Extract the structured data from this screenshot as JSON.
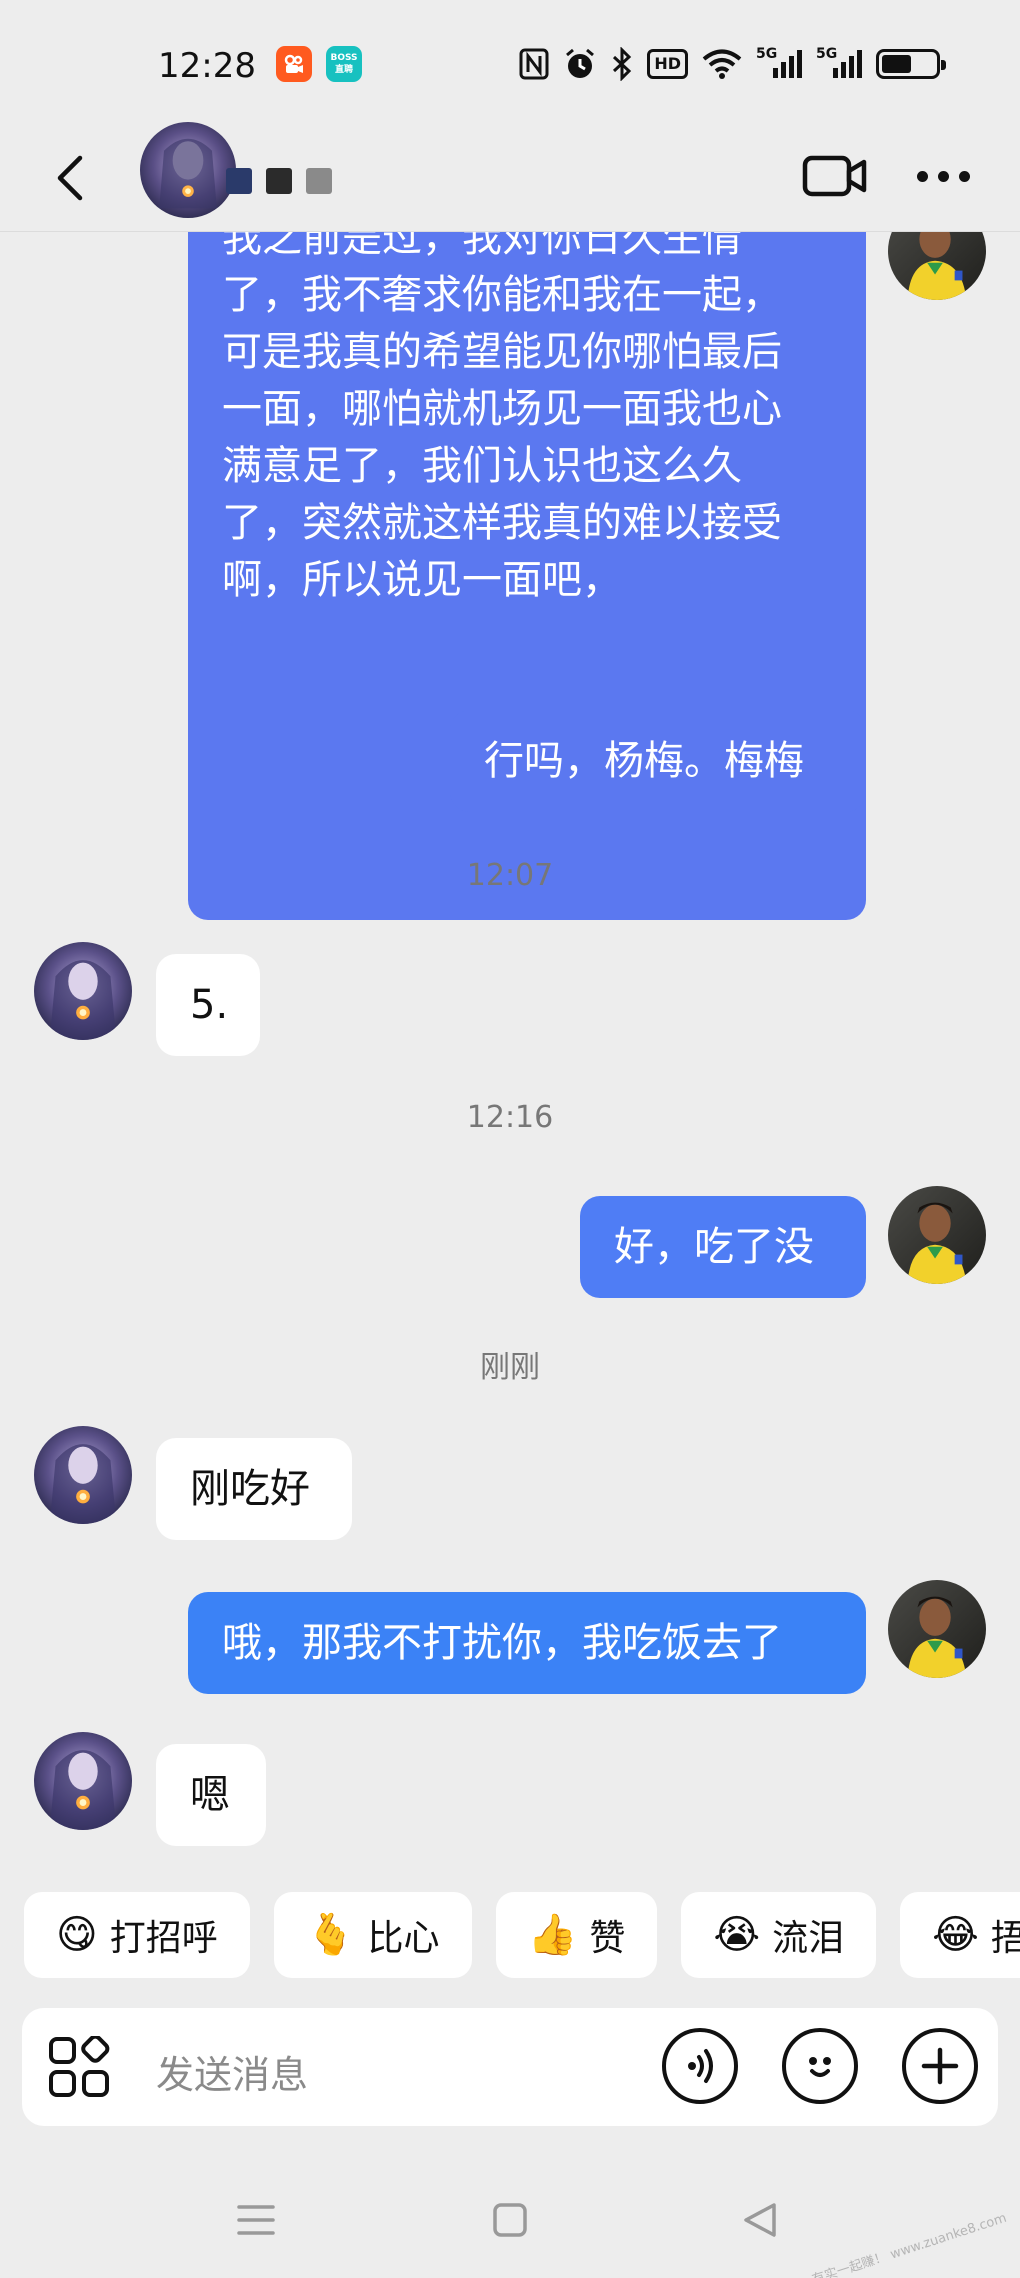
{
  "status_bar": {
    "time": "12:28",
    "apps": [
      {
        "name": "kuaishou-icon",
        "color": "#ff5a1f"
      },
      {
        "name": "boss-zhipin-icon",
        "line1": "BOSS",
        "line2": "直聘",
        "color": "#17c1c0"
      }
    ],
    "icons": [
      "nfc-icon",
      "alarm-icon",
      "bluetooth-icon",
      "hd-voice-icon",
      "wifi-icon",
      "signal-5g-icon",
      "signal-5g-icon",
      "battery-icon"
    ],
    "hd_label": "HD",
    "network_label": "5G",
    "battery_level": 0.6
  },
  "header": {
    "contact_name_redacted_colors": [
      "#2a3a6a",
      "#2b2b2b",
      "#8a8a8a"
    ]
  },
  "messages": [
    {
      "type": "sent",
      "lines": [
        "我之前是过，我对你日久生情",
        "了，我不奢求你能和我在一起，",
        "可是我真的希望能见你哪怕最后",
        "一面，哪怕就机场见一面我也心",
        "满意足了，我们认识也这么久",
        "了，突然就这样我真的难以接受",
        "啊，所以说见一面吧，"
      ]
    },
    {
      "type": "sent",
      "text": "行吗，杨梅。梅梅"
    },
    {
      "type": "time",
      "text": "12:07"
    },
    {
      "type": "received",
      "text": "5."
    },
    {
      "type": "time",
      "text": "12:16"
    },
    {
      "type": "sent",
      "text": "好，吃了没"
    },
    {
      "type": "time",
      "text": "刚刚"
    },
    {
      "type": "received",
      "text": "刚吃好"
    },
    {
      "type": "sent",
      "text": "哦，那我不打扰你，我吃饭去了"
    },
    {
      "type": "received",
      "text": "嗯"
    }
  ],
  "quick_replies": [
    {
      "emoji": "😋",
      "label": "打招呼"
    },
    {
      "emoji": "🫰",
      "label": "比心"
    },
    {
      "emoji": "👍",
      "label": "赞"
    },
    {
      "emoji": "😭",
      "label": "流泪"
    },
    {
      "emoji": "😂",
      "label": "捂脸"
    }
  ],
  "input": {
    "placeholder": "发送消息"
  },
  "colors": {
    "sent_bubble": "#5b78f0",
    "sent_bubble_latest": "#3b82f6",
    "received_bubble": "#ffffff",
    "background": "#ededed"
  },
  "watermark": "赚客吧，有实一起赚！ www.zuanke8.com"
}
